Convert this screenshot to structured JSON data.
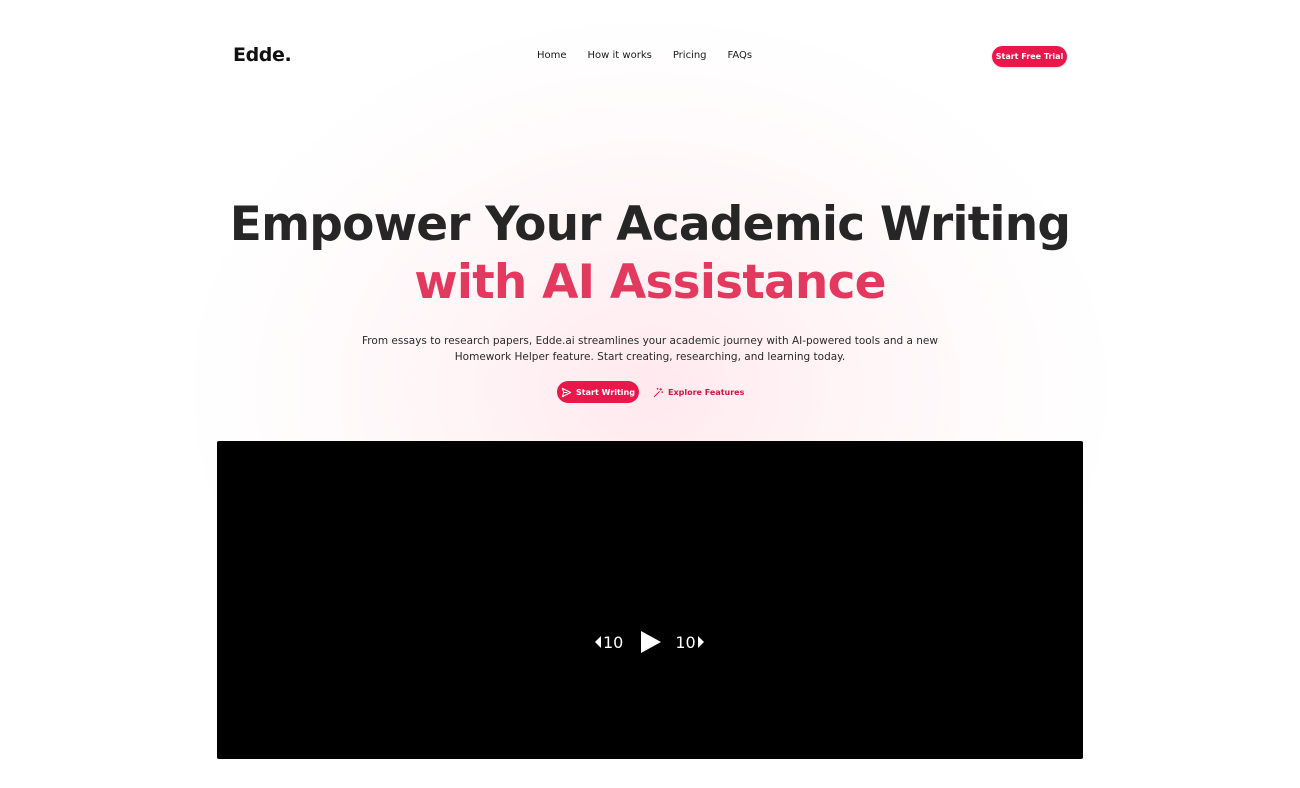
{
  "brand": {
    "logo": "Edde."
  },
  "nav": {
    "links": [
      "Home",
      "How it works",
      "Pricing",
      "FAQs"
    ],
    "cta": "Start Free Trial"
  },
  "hero": {
    "title_line1": "Empower Your Academic Writing",
    "title_line2": "with AI Assistance",
    "description_line1": "From essays to research papers, Edde.ai streamlines your academic journey with AI-powered tools and a new",
    "description_line2": "Homework Helper feature. Start creating, researching, and learning today.",
    "primary_cta": "Start Writing",
    "primary_cta_icon": "send-icon",
    "secondary_cta": "Explore Features",
    "secondary_cta_icon": "magic-wand-icon"
  },
  "video": {
    "rewind_seconds": "10",
    "forward_seconds": "10",
    "play_icon": "play-icon"
  },
  "colors": {
    "accent": "#e8194a",
    "accent_text": "#e4395e",
    "title": "#262626",
    "video_bg": "#000000"
  }
}
